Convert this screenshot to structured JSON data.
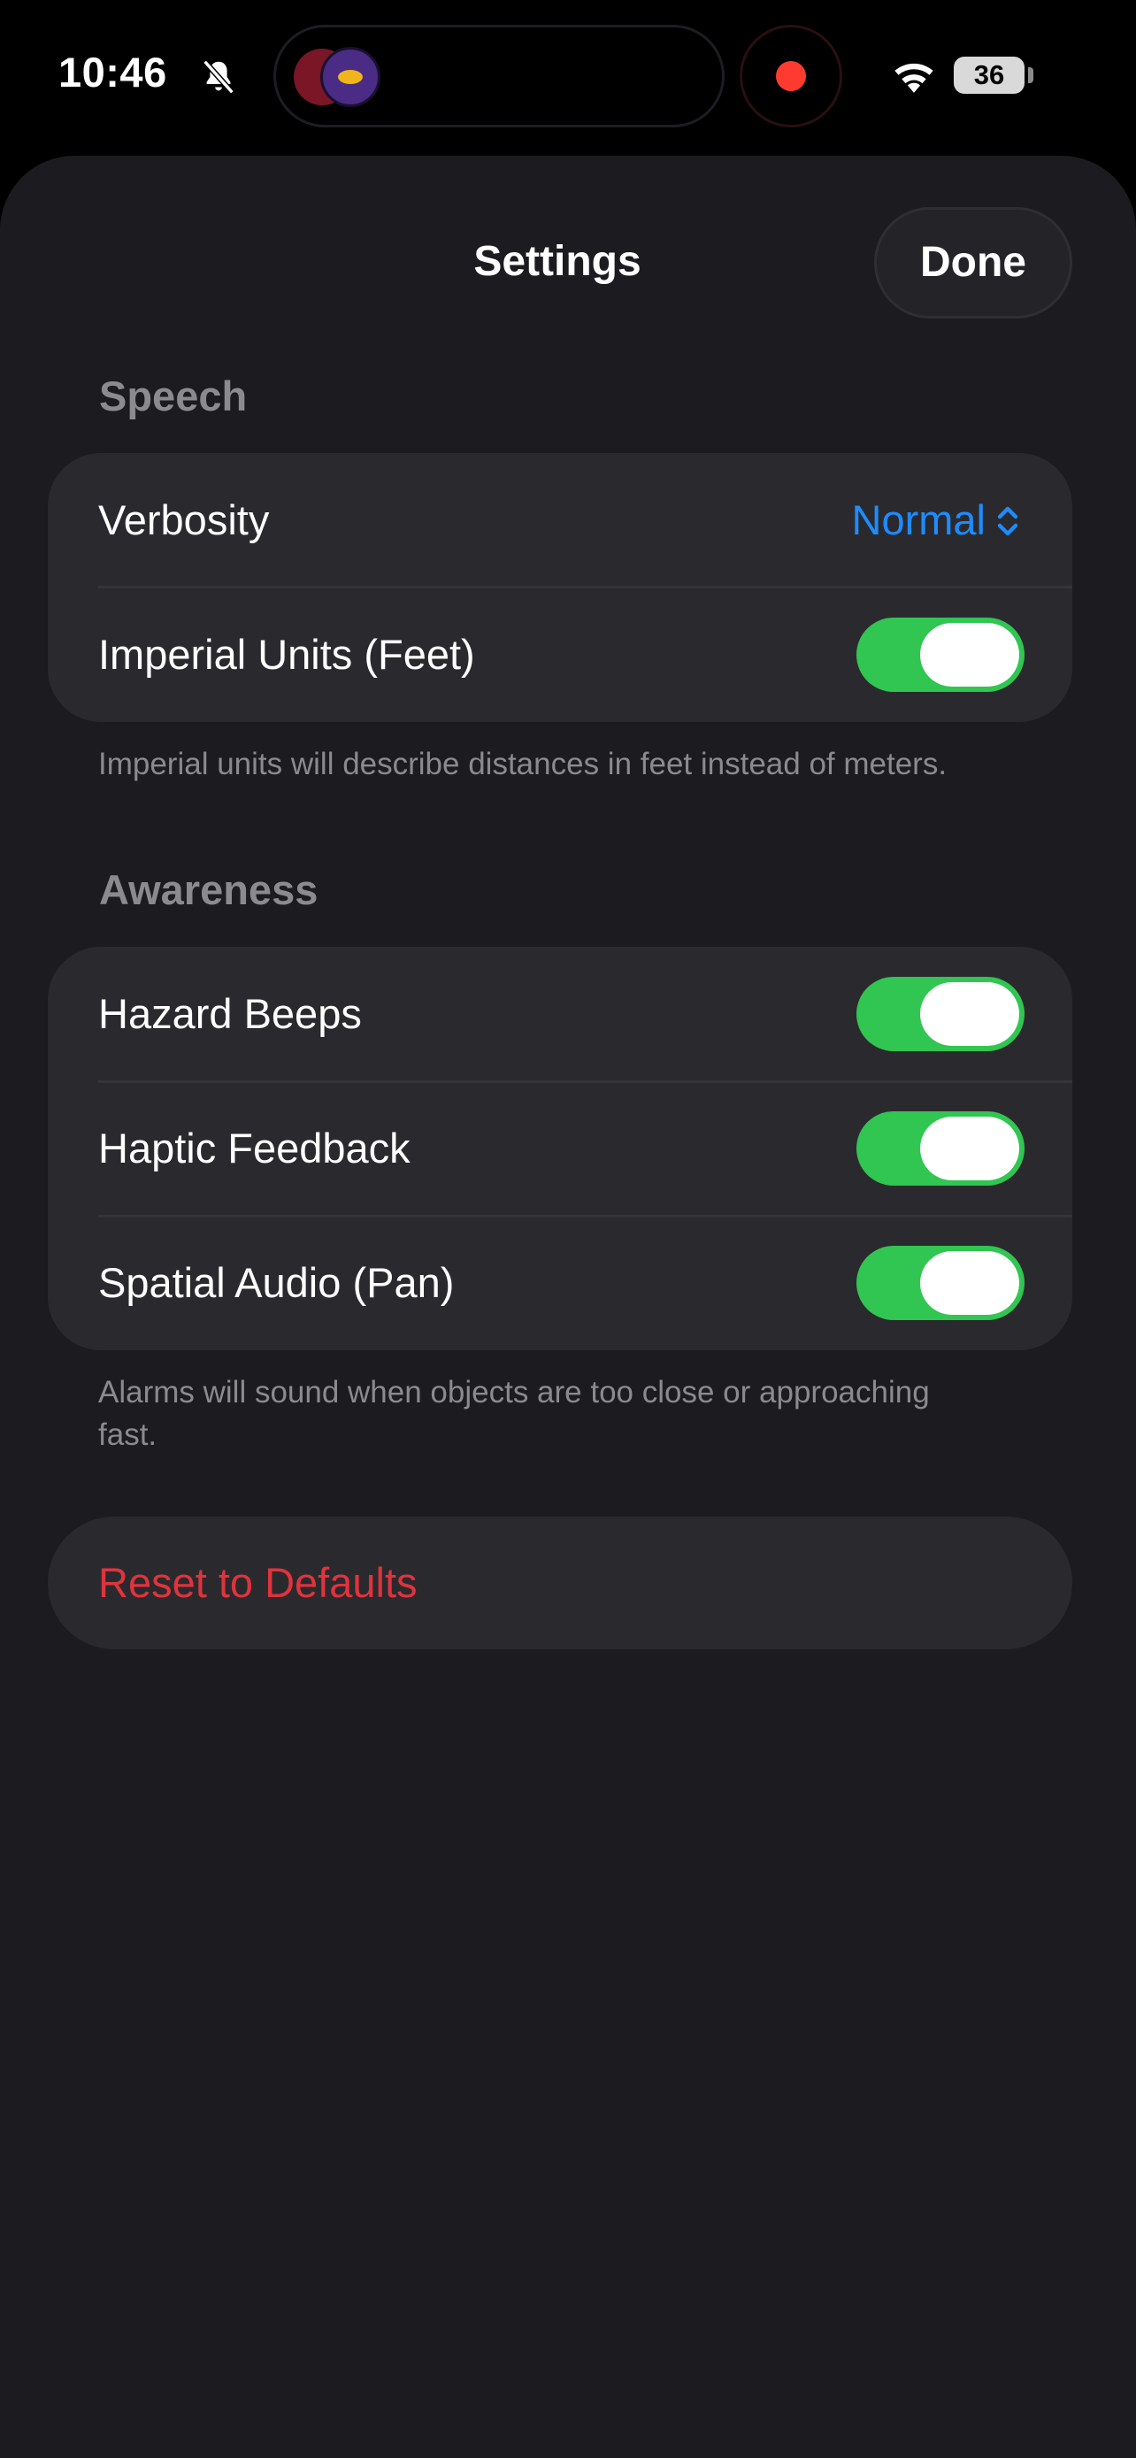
{
  "status_bar": {
    "time": "10:46",
    "battery": "36",
    "icons": [
      "bell-slash-icon",
      "wifi-icon",
      "battery-icon"
    ],
    "recording_color": "#ff3b30"
  },
  "header": {
    "title": "Settings",
    "done_label": "Done"
  },
  "speech": {
    "header": "Speech",
    "verbosity_label": "Verbosity",
    "verbosity_value": "Normal",
    "imperial_label": "Imperial Units (Feet)",
    "imperial_on": true,
    "footer": "Imperial units will describe distances in feet instead of meters."
  },
  "awareness": {
    "header": "Awareness",
    "rows": [
      {
        "label": "Hazard Beeps",
        "on": true
      },
      {
        "label": "Haptic Feedback",
        "on": true
      },
      {
        "label": "Spatial Audio (Pan)",
        "on": true
      }
    ],
    "footer": "Alarms will sound when objects are too close or approaching fast."
  },
  "reset": {
    "label": "Reset to Defaults"
  },
  "colors": {
    "accent": "#1e8cff",
    "toggle_on": "#31c552",
    "destructive": "#e0333c",
    "sheet_background": "#1c1c20",
    "card_background": "#2a2a2e"
  }
}
